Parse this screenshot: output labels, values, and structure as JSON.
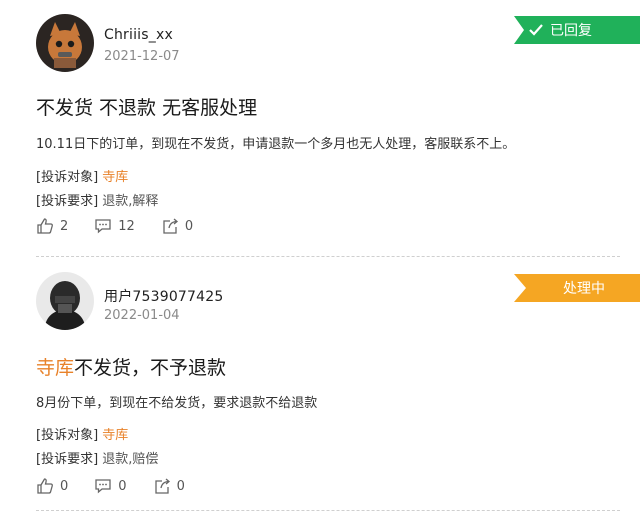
{
  "posts": [
    {
      "username": "Chriiis_xx",
      "date": "2021-12-07",
      "status": "已回复",
      "title": "不发货 不退款 无客服处理",
      "description": "10.11日下的订单，到现在不发货，申请退款一个多月也无人处理，客服联系不上。",
      "complaint_target_label": "[投诉对象]",
      "complaint_target_value": "寺库",
      "complaint_demand_label": "[投诉要求]",
      "complaint_demand_value": "退款,解释",
      "likes": "2",
      "comments": "12",
      "shares": "0",
      "status_color": "#20b15a"
    },
    {
      "username": "用户7539077425",
      "date": "2022-01-04",
      "status": "处理中",
      "title_highlight": "寺库",
      "title_rest": "不发货，不予退款",
      "description": "8月份下单，到现在不给发货，要求退款不给退款",
      "complaint_target_label": "[投诉对象]",
      "complaint_target_value": "寺库",
      "complaint_demand_label": "[投诉要求]",
      "complaint_demand_value": "退款,赔偿",
      "likes": "0",
      "comments": "0",
      "shares": "0",
      "status_color": "#f5a623"
    }
  ],
  "colors": {
    "accent": "#e8822a",
    "replied": "#20b15a",
    "processing": "#f5a623"
  }
}
